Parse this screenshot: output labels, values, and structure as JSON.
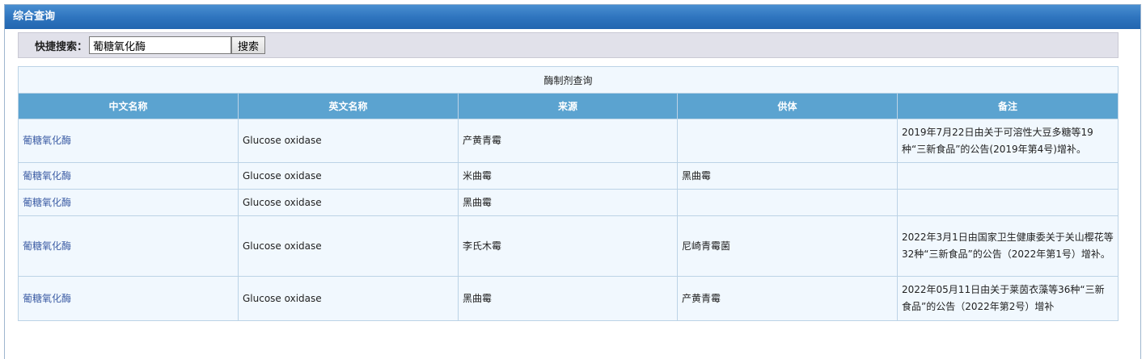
{
  "panel": {
    "title": "综合查询"
  },
  "search": {
    "label": "快捷搜索：",
    "value": "葡糖氧化酶",
    "button_label": "搜索"
  },
  "table": {
    "caption": "酶制剂查询",
    "headers": [
      "中文名称",
      "英文名称",
      "来源",
      "供体",
      "备注"
    ],
    "rows": [
      {
        "name_cn": "葡糖氧化酶",
        "name_en": "Glucose oxidase",
        "source": "产黄青霉",
        "donor": "",
        "note": "2019年7月22日由关于可溶性大豆多糖等19种“三新食品”的公告(2019年第4号)增补。"
      },
      {
        "name_cn": "葡糖氧化酶",
        "name_en": "Glucose oxidase",
        "source": "米曲霉",
        "donor": "黑曲霉",
        "note": ""
      },
      {
        "name_cn": "葡糖氧化酶",
        "name_en": "Glucose oxidase",
        "source": "黑曲霉",
        "donor": "",
        "note": ""
      },
      {
        "name_cn": "葡糖氧化酶",
        "name_en": "Glucose oxidase",
        "source": "李氏木霉",
        "donor": "尼崎青霉菌",
        "note": "2022年3月1日由国家卫生健康委关于关山樱花等32种“三新食品”的公告（2022年第1号）增补。"
      },
      {
        "name_cn": "葡糖氧化酶",
        "name_en": "Glucose oxidase",
        "source": "黑曲霉",
        "donor": "产黄青霉",
        "note": "2022年05月11日由关于莱茵衣藻等36种“三新食品”的公告（2022年第2号）增补"
      }
    ]
  }
}
